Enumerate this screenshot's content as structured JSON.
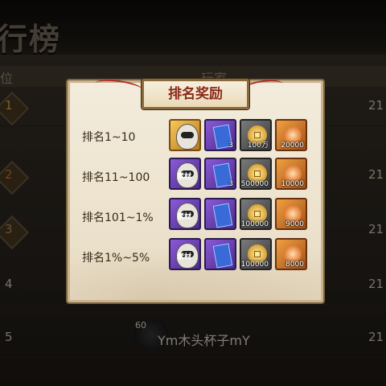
{
  "background": {
    "title": "行榜",
    "header_rank": "位",
    "header_player": "玩家",
    "rows": [
      {
        "rank": "1",
        "score": "21"
      },
      {
        "rank": "2",
        "score": "21"
      },
      {
        "rank": "3",
        "score": "21"
      },
      {
        "rank": "4",
        "score": "21"
      },
      {
        "rank": "5",
        "score": "21"
      }
    ],
    "visible_player": {
      "level": "60",
      "name": "Ym木头杯子mY"
    }
  },
  "modal": {
    "title": "排名奖励",
    "tiers": [
      {
        "label": "排名1~10",
        "rewards": [
          {
            "icon": "daruma-gold-icon",
            "quality": "gold",
            "qty": ""
          },
          {
            "icon": "ticket-icon",
            "quality": "purple",
            "qty": "3"
          },
          {
            "icon": "coin-icon",
            "quality": "grey",
            "qty": "100万"
          },
          {
            "icon": "gem-icon",
            "quality": "orange",
            "qty": "20000"
          }
        ]
      },
      {
        "label": "排名11~100",
        "rewards": [
          {
            "icon": "material-icon",
            "quality": "purple",
            "qty": "",
            "tag": "素材"
          },
          {
            "icon": "ticket-icon",
            "quality": "purple",
            "qty": "3"
          },
          {
            "icon": "coin-icon",
            "quality": "grey",
            "qty": "500000"
          },
          {
            "icon": "gem-icon",
            "quality": "orange",
            "qty": "10000"
          }
        ]
      },
      {
        "label": "排名101~1%",
        "rewards": [
          {
            "icon": "material-icon",
            "quality": "purple",
            "qty": "",
            "tag": "素材"
          },
          {
            "icon": "ticket-icon",
            "quality": "purple",
            "qty": ""
          },
          {
            "icon": "coin-icon",
            "quality": "grey",
            "qty": "100000"
          },
          {
            "icon": "gem-icon",
            "quality": "orange",
            "qty": "9000"
          }
        ]
      },
      {
        "label": "排名1%~5%",
        "rewards": [
          {
            "icon": "material-icon",
            "quality": "purple",
            "qty": "",
            "tag": "素材"
          },
          {
            "icon": "ticket-icon",
            "quality": "purple",
            "qty": ""
          },
          {
            "icon": "coin-icon",
            "quality": "grey",
            "qty": "100000"
          },
          {
            "icon": "gem-icon",
            "quality": "orange",
            "qty": "8000"
          }
        ]
      }
    ]
  }
}
